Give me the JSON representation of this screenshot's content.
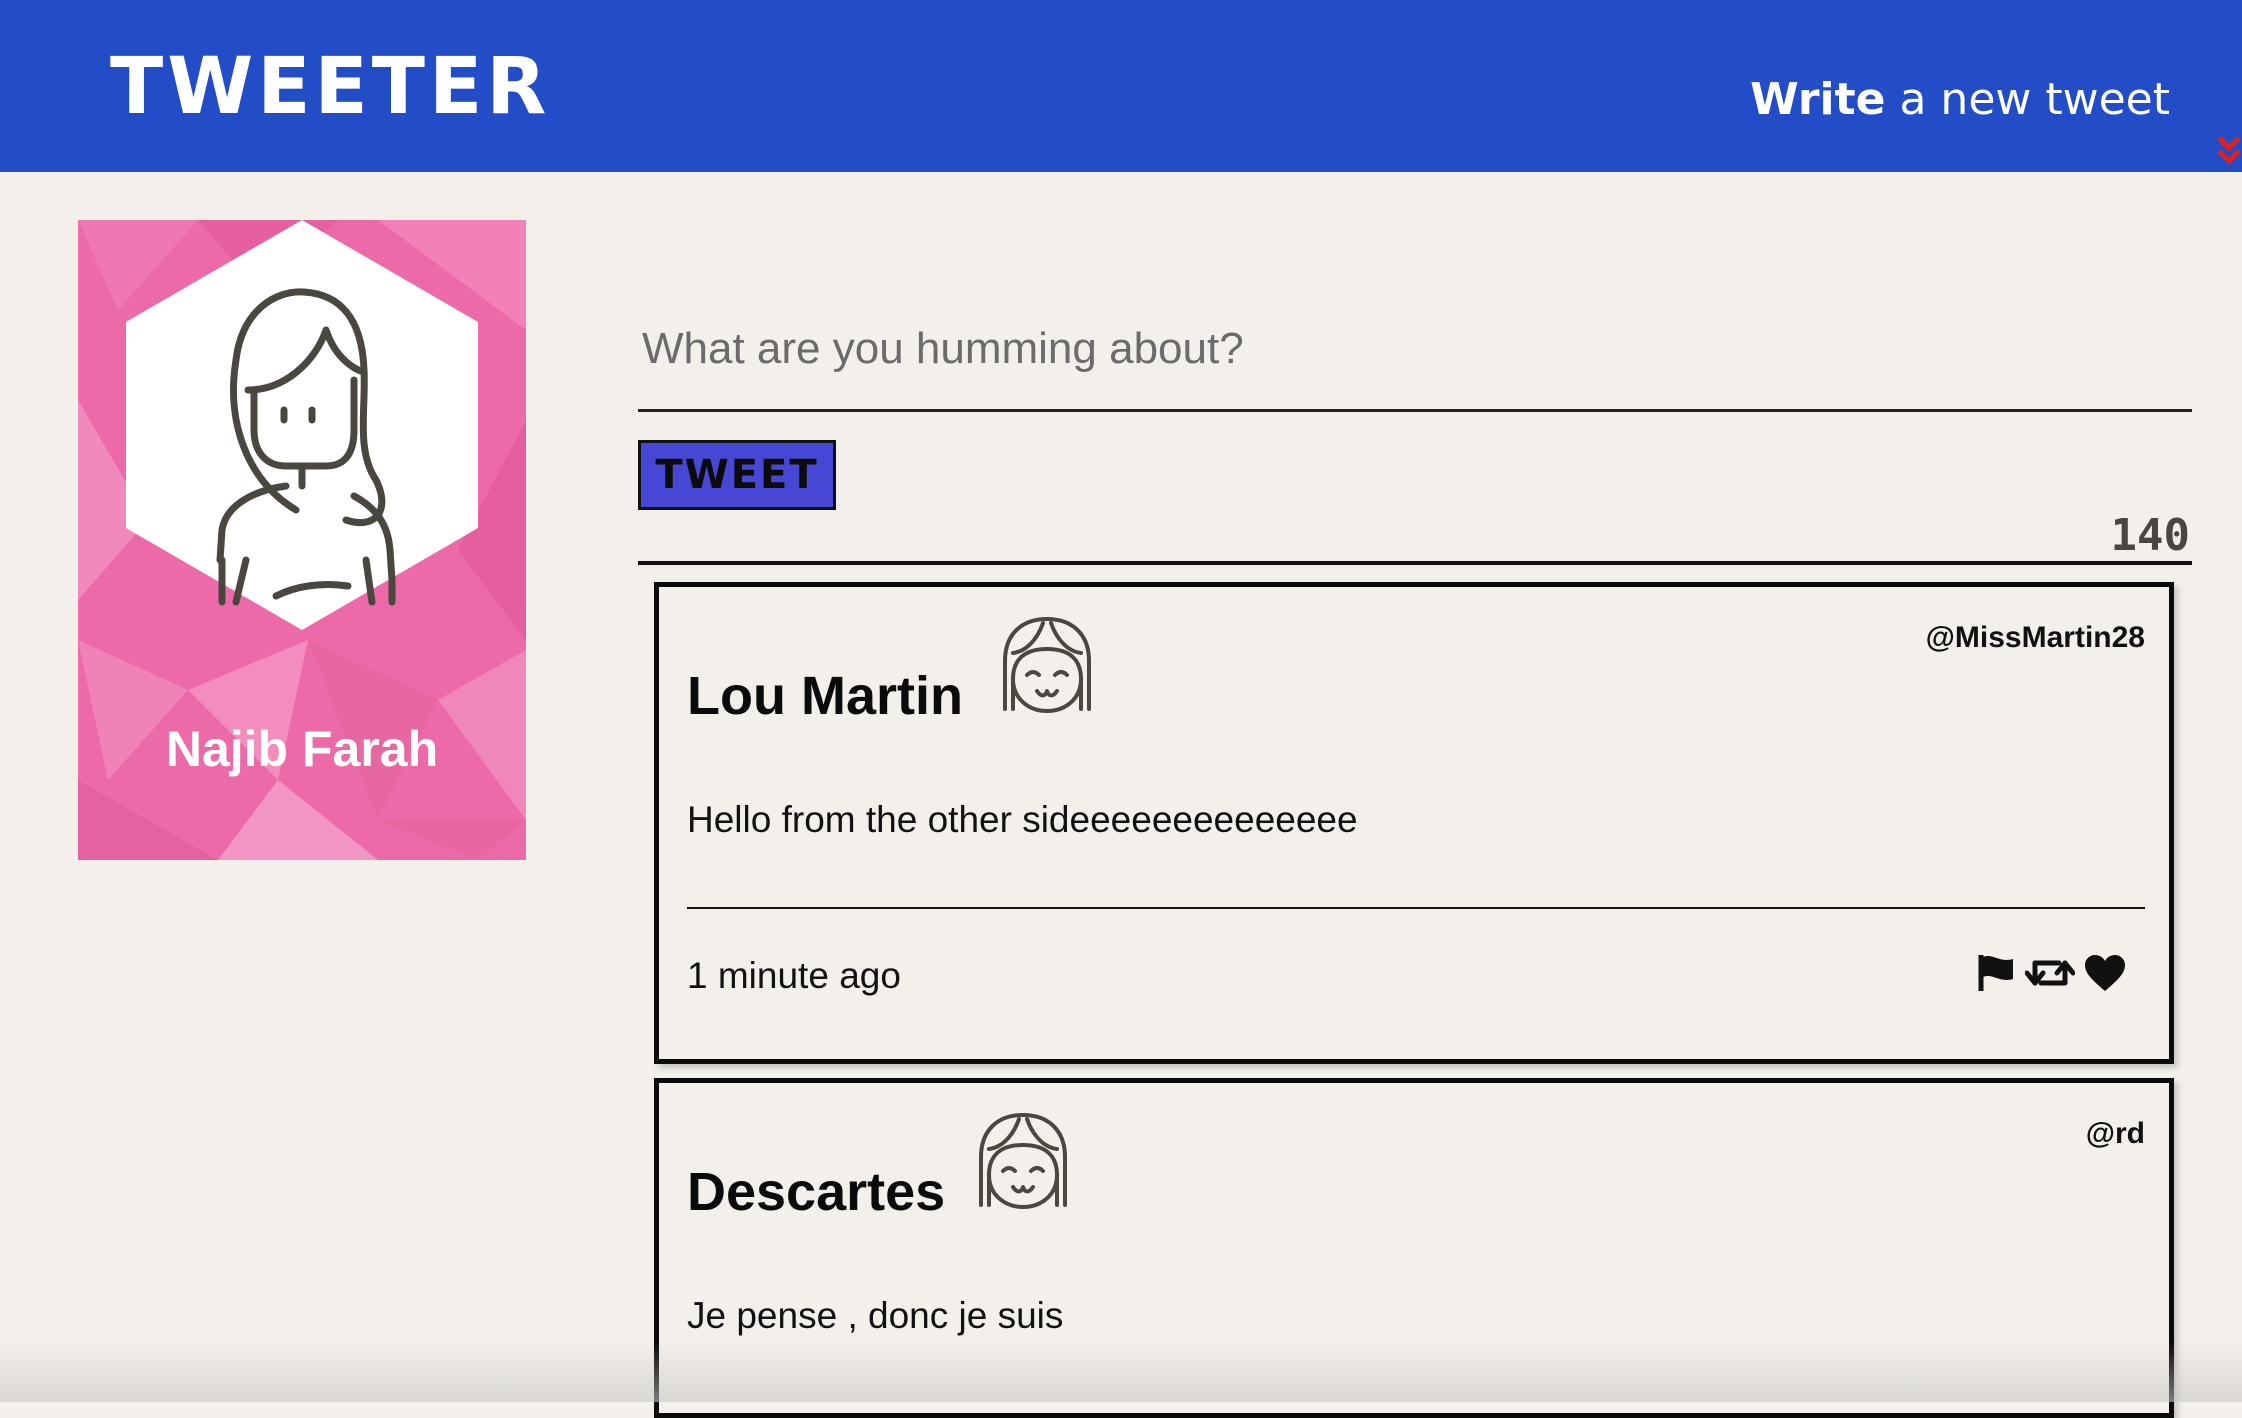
{
  "nav": {
    "brand": "TWEETER",
    "compose_bold": "Write",
    "compose_rest": " a new tweet"
  },
  "profile": {
    "name": "Najib Farah"
  },
  "compose": {
    "placeholder": "What are you humming about?",
    "button_label": "TWEET",
    "char_count": "140"
  },
  "tweets": [
    {
      "name": "Lou Martin",
      "handle": "@MissMartin28",
      "text": "Hello from the other sideeeeeeeeeeeeee",
      "time": "1 minute ago"
    },
    {
      "name": "Descartes",
      "handle": "@rd",
      "text": "Je pense , donc je suis",
      "time": ""
    }
  ],
  "icons": {
    "flag": "flag-icon",
    "retweet": "retweet-icon",
    "like": "heart-icon",
    "toggle": "double-chevron-down-icon"
  },
  "colors": {
    "nav": "#234dc7",
    "background": "#f3f0eb",
    "profile_card": "#ec6aa8",
    "tweet_button": "#4747d6",
    "chevron": "#e0201d"
  }
}
